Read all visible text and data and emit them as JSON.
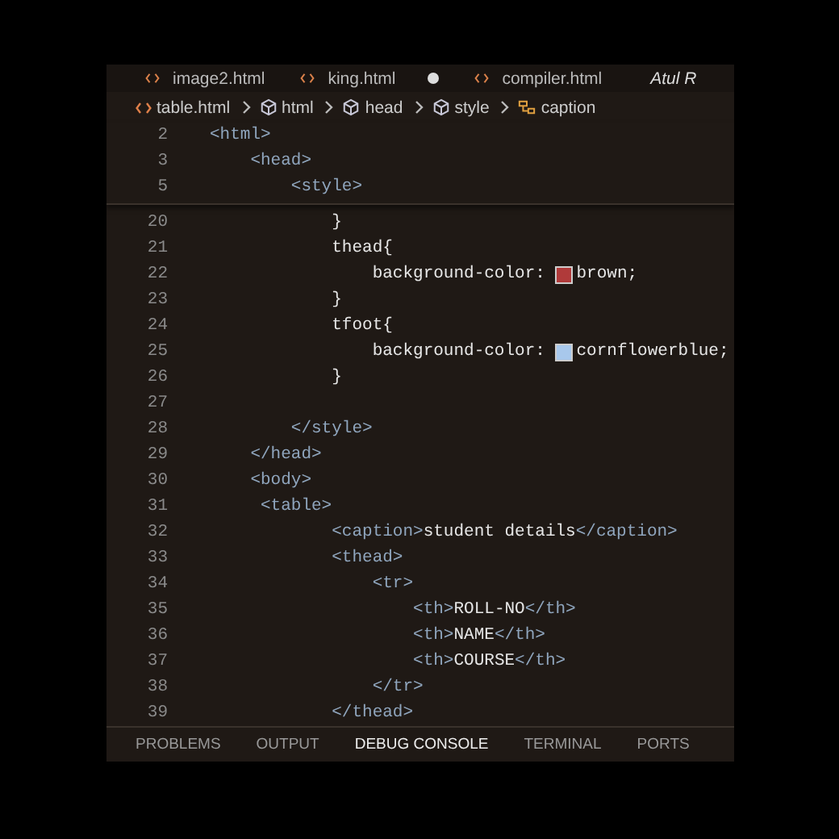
{
  "tabs": [
    {
      "label": "image2.html",
      "modified": false,
      "selected": false
    },
    {
      "label": "king.html",
      "modified": true,
      "selected": false
    },
    {
      "label": "compiler.html",
      "modified": false,
      "selected": false
    }
  ],
  "tab_bar_extra": {
    "label": "Atul R"
  },
  "breadcrumbs": [
    {
      "label": "table.html",
      "kind": "file"
    },
    {
      "label": "html",
      "kind": "element"
    },
    {
      "label": "head",
      "kind": "element"
    },
    {
      "label": "style",
      "kind": "element"
    },
    {
      "label": "caption",
      "kind": "caption"
    }
  ],
  "sticky_lines": [
    {
      "number": "2",
      "tokens": [
        {
          "kind": "tag",
          "text": "<html>"
        }
      ]
    },
    {
      "number": "3",
      "tokens": [
        {
          "kind": "tag",
          "text": "    <head>"
        }
      ]
    },
    {
      "number": "5",
      "tokens": [
        {
          "kind": "tag",
          "text": "        <style>"
        }
      ]
    }
  ],
  "lines": [
    {
      "number": "20",
      "tokens": [
        {
          "kind": "text",
          "text": "            }"
        }
      ]
    },
    {
      "number": "21",
      "tokens": [
        {
          "kind": "text",
          "text": "            thead{"
        }
      ]
    },
    {
      "number": "22",
      "tokens": [
        {
          "kind": "text",
          "text": "                background-color: "
        },
        {
          "kind": "swatch",
          "color": "#b03a3a"
        },
        {
          "kind": "text",
          "text": "brown;"
        }
      ]
    },
    {
      "number": "23",
      "tokens": [
        {
          "kind": "text",
          "text": "            }"
        }
      ]
    },
    {
      "number": "24",
      "tokens": [
        {
          "kind": "text",
          "text": "            tfoot{"
        }
      ]
    },
    {
      "number": "25",
      "tokens": [
        {
          "kind": "text",
          "text": "                background-color: "
        },
        {
          "kind": "swatch",
          "color": "#a8c8ec"
        },
        {
          "kind": "text",
          "text": "cornflowerblue;"
        }
      ]
    },
    {
      "number": "26",
      "tokens": [
        {
          "kind": "text",
          "text": "            }"
        }
      ]
    },
    {
      "number": "27"
    },
    {
      "number": "28",
      "tokens": [
        {
          "kind": "tag",
          "text": "        </style>"
        }
      ]
    },
    {
      "number": "29",
      "tokens": [
        {
          "kind": "tag",
          "text": "    </head>"
        }
      ]
    },
    {
      "number": "30",
      "tokens": [
        {
          "kind": "tag",
          "text": "    <body>"
        }
      ]
    },
    {
      "number": "31",
      "tokens": [
        {
          "kind": "tag",
          "text": "     <table>"
        }
      ]
    },
    {
      "number": "32",
      "tokens": [
        {
          "kind": "tag",
          "text": "            <caption>"
        },
        {
          "kind": "text",
          "text": "student details"
        },
        {
          "kind": "tag",
          "text": "</caption>"
        }
      ]
    },
    {
      "number": "33",
      "tokens": [
        {
          "kind": "tag",
          "text": "            <thead>"
        }
      ]
    },
    {
      "number": "34",
      "tokens": [
        {
          "kind": "tag",
          "text": "                <tr>"
        }
      ]
    },
    {
      "number": "35",
      "tokens": [
        {
          "kind": "tag",
          "text": "                    <th>"
        },
        {
          "kind": "text",
          "text": "ROLL-NO"
        },
        {
          "kind": "tag",
          "text": "</th>"
        }
      ]
    },
    {
      "number": "36",
      "tokens": [
        {
          "kind": "tag",
          "text": "                    <th>"
        },
        {
          "kind": "text",
          "text": "NAME"
        },
        {
          "kind": "tag",
          "text": "</th>"
        }
      ]
    },
    {
      "number": "37",
      "tokens": [
        {
          "kind": "tag",
          "text": "                    <th>"
        },
        {
          "kind": "text",
          "text": "COURSE"
        },
        {
          "kind": "tag",
          "text": "</th>"
        }
      ]
    },
    {
      "number": "38",
      "tokens": [
        {
          "kind": "tag",
          "text": "                </tr>"
        }
      ]
    },
    {
      "number": "39",
      "tokens": [
        {
          "kind": "tag",
          "text": "            </thead>"
        }
      ]
    }
  ],
  "panel_tabs": [
    {
      "label": "PROBLEMS",
      "selected": false
    },
    {
      "label": "OUTPUT",
      "selected": false
    },
    {
      "label": "DEBUG CONSOLE",
      "selected": true
    },
    {
      "label": "TERMINAL",
      "selected": false
    },
    {
      "label": "PORTS",
      "selected": false
    }
  ]
}
